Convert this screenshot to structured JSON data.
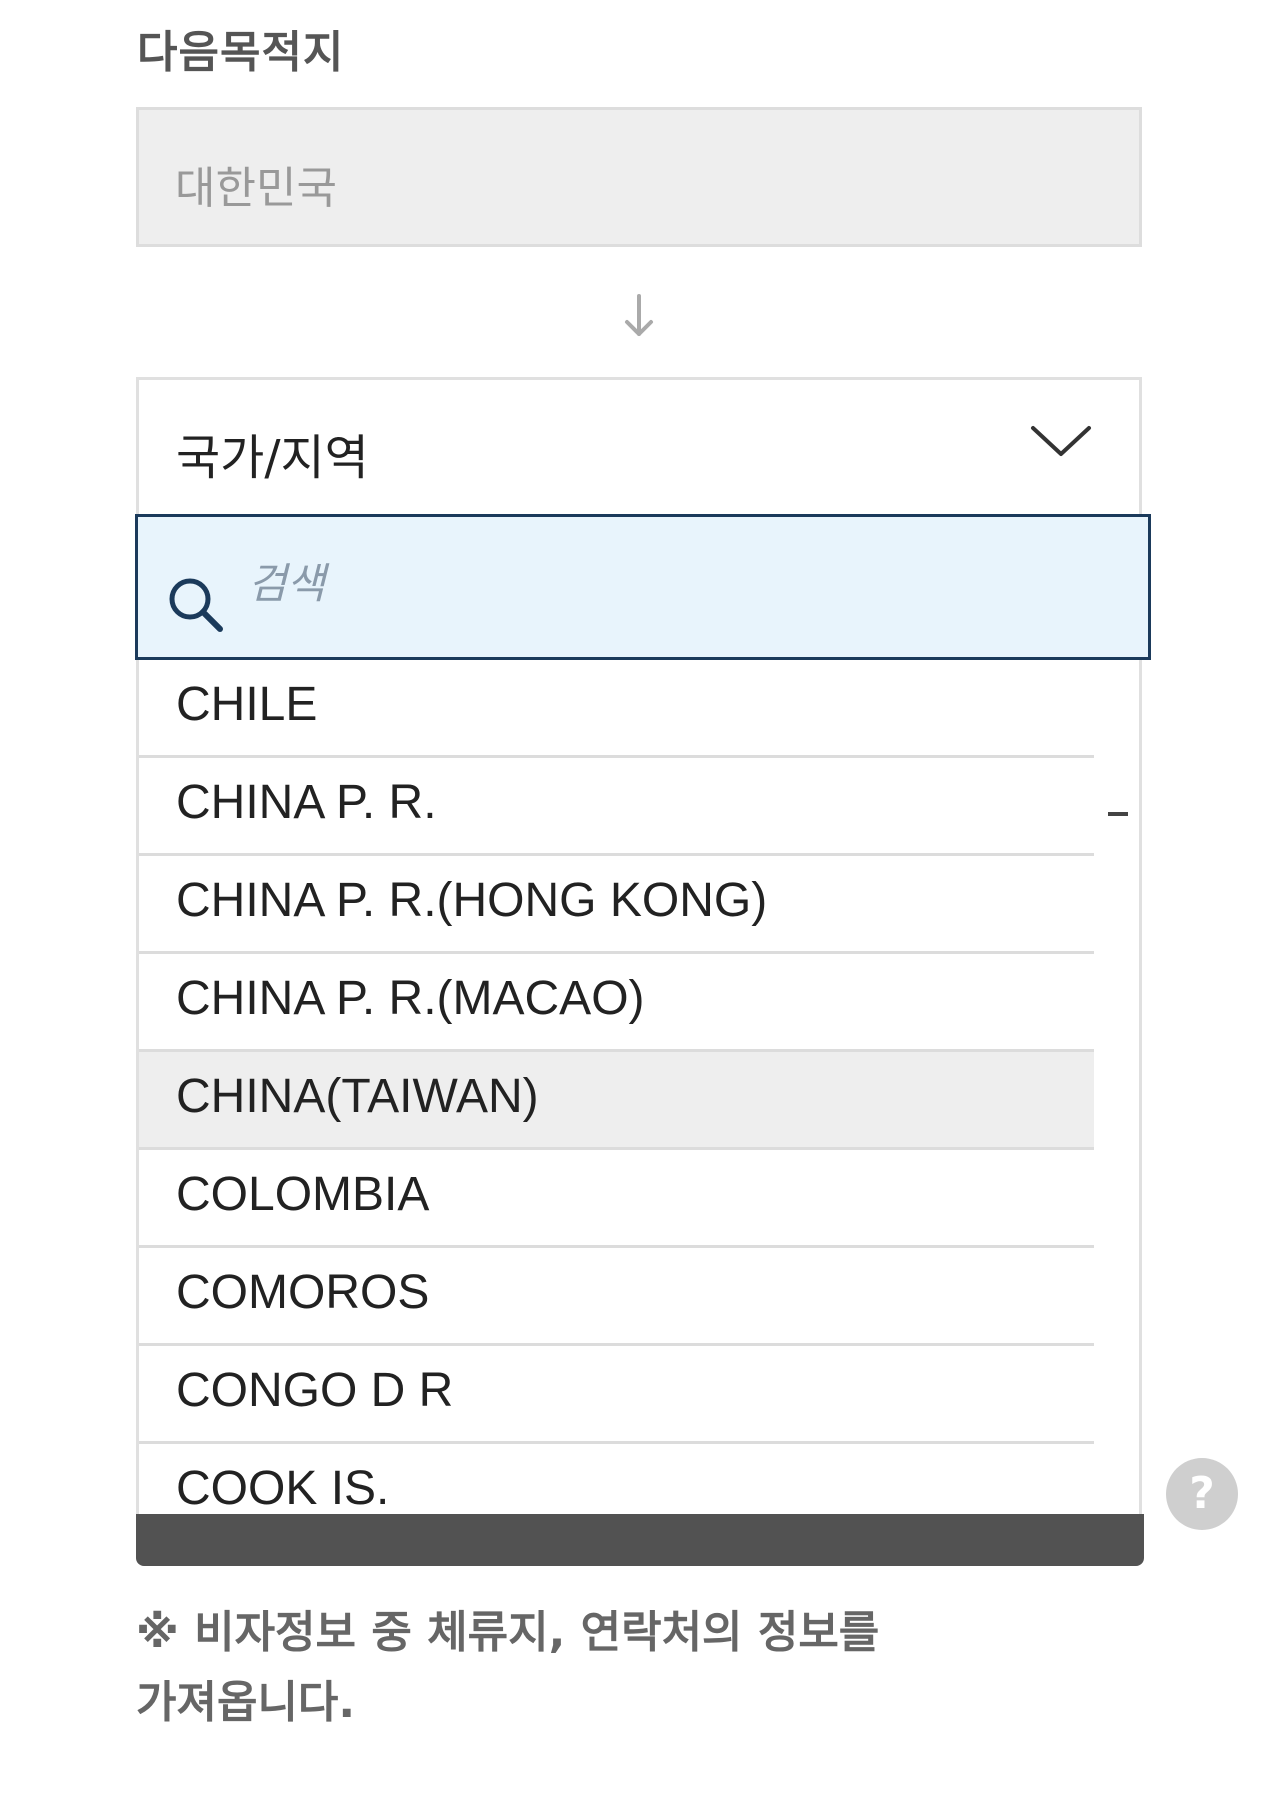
{
  "next_destination": {
    "label": "다음목적지",
    "origin_value": "대한민국"
  },
  "country_select": {
    "label": "국가/지역",
    "search_placeholder": "검색",
    "options": [
      "CHILE",
      "CHINA P. R.",
      "CHINA P. R.(HONG KONG)",
      "CHINA P. R.(MACAO)",
      "CHINA(TAIWAN)",
      "COLOMBIA",
      "COMOROS",
      "CONGO D R",
      "COOK IS."
    ],
    "highlighted_option": "CHINA(TAIWAN)"
  },
  "help": {
    "icon": "question-icon",
    "label": "?"
  },
  "footnote": {
    "line1": "※ 비자정보 중 체류지, 연락처의 정보를",
    "line2": "가져옵니다."
  },
  "icons": {
    "arrow": "arrow-down-icon",
    "chevron": "chevron-down-icon",
    "search": "search-icon"
  },
  "colors": {
    "search_bg": "#e8f4fc",
    "search_border": "#1b3a5b",
    "highlight_bg": "#eeeeee",
    "bottom_bar": "#525252"
  }
}
